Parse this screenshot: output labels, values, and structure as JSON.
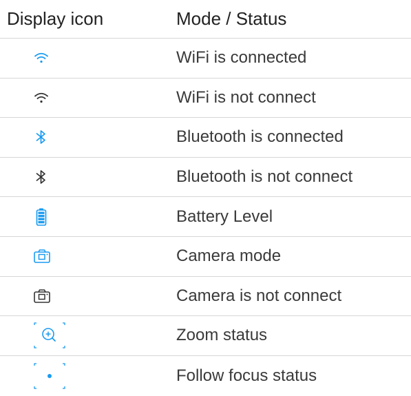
{
  "header": {
    "icon_col": "Display icon",
    "status_col": "Mode / Status"
  },
  "colors": {
    "blue": "#1a9bf0",
    "dark": "#333333",
    "divider": "#d6d6d6"
  },
  "rows": [
    {
      "icon": "wifi-connected-icon",
      "status": "WiFi is connected"
    },
    {
      "icon": "wifi-disconnected-icon",
      "status": "WiFi is not connect"
    },
    {
      "icon": "bluetooth-connected-icon",
      "status": "Bluetooth is connected"
    },
    {
      "icon": "bluetooth-disconnected-icon",
      "status": "Bluetooth is not connect"
    },
    {
      "icon": "battery-icon",
      "status": "Battery Level"
    },
    {
      "icon": "camera-mode-icon",
      "status": "Camera mode"
    },
    {
      "icon": "camera-disconnected-icon",
      "status": "Camera is not connect"
    },
    {
      "icon": "zoom-status-icon",
      "status": "Zoom status"
    },
    {
      "icon": "follow-focus-icon",
      "status": "Follow focus status"
    }
  ]
}
